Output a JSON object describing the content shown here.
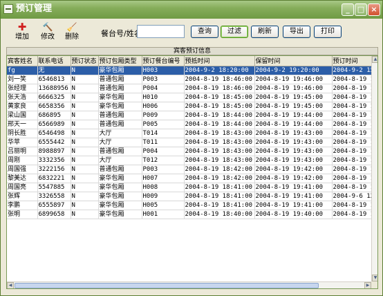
{
  "window": {
    "title": "预订管理"
  },
  "toolbar": {
    "tools": [
      {
        "label": "增加",
        "icon": "add-icon"
      },
      {
        "label": "修改",
        "icon": "hammer-icon"
      },
      {
        "label": "删除",
        "icon": "broom-icon"
      }
    ],
    "search_label": "餐台号/姓名：",
    "search_value": "",
    "buttons": [
      "查询",
      "过滤",
      "刷新",
      "导出",
      "打印"
    ],
    "active_button": "过滤"
  },
  "grid": {
    "section_title": "宾客预订信息",
    "columns": [
      "宾客姓名",
      "联系电话",
      "预订状态",
      "预订包厢类型",
      "预订餐台编号",
      "预抵时间",
      "保留时间",
      "预订时间"
    ],
    "rows": [
      [
        "fg",
        "无",
        "N",
        "豪华包厢",
        "H003",
        "2004-9-2 18:20:00",
        "2004-9-2 19:20:00",
        "2004-9-2 15"
      ],
      [
        "刘一笑",
        "6546813",
        "N",
        "普通包厢",
        "P003",
        "2004-8-19 18:46:00",
        "2004-8-19 19:46:00",
        "2004-8-19 1"
      ],
      [
        "张经理",
        "13688956",
        "N",
        "普通包厢",
        "P004",
        "2004-8-19 18:46:00",
        "2004-8-19 19:46:00",
        "2004-8-19 1"
      ],
      [
        "张天浩",
        "6666325",
        "N",
        "豪华包厢",
        "H010",
        "2004-8-19 18:45:00",
        "2004-8-19 19:45:00",
        "2004-8-19 1"
      ],
      [
        "黄家良",
        "6658356",
        "N",
        "豪华包厢",
        "H006",
        "2004-8-19 18:45:00",
        "2004-8-19 19:45:00",
        "2004-8-19 1"
      ],
      [
        "梁山国",
        "686895",
        "N",
        "普通包厢",
        "P009",
        "2004-8-19 18:44:00",
        "2004-8-19 19:44:00",
        "2004-8-19 1"
      ],
      [
        "邢天一",
        "6566989",
        "N",
        "普通包厢",
        "P005",
        "2004-8-19 18:44:00",
        "2004-8-19 19:44:00",
        "2004-8-19 1"
      ],
      [
        "阴长胜",
        "6546498",
        "N",
        "大厅",
        "T014",
        "2004-8-19 18:43:00",
        "2004-8-19 19:43:00",
        "2004-8-19 1"
      ],
      [
        "华苹",
        "6555442",
        "N",
        "大厅",
        "T011",
        "2004-8-19 18:43:00",
        "2004-8-19 19:43:00",
        "2004-8-19 1"
      ],
      [
        "吕丽明",
        "8988897",
        "N",
        "普通包厢",
        "P004",
        "2004-8-19 18:43:00",
        "2004-8-19 19:43:00",
        "2004-8-19 1"
      ],
      [
        "周刚",
        "3332356",
        "N",
        "大厅",
        "T012",
        "2004-8-19 18:43:00",
        "2004-8-19 19:43:00",
        "2004-8-19 1"
      ],
      [
        "周国强",
        "3222156",
        "N",
        "普通包厢",
        "P003",
        "2004-8-19 18:42:00",
        "2004-8-19 19:42:00",
        "2004-8-19 1"
      ],
      [
        "黎美达",
        "6832221",
        "N",
        "豪华包厢",
        "H007",
        "2004-8-19 18:42:00",
        "2004-8-19 19:42:00",
        "2004-8-19 1"
      ],
      [
        "周国亮",
        "5547885",
        "N",
        "豪华包厢",
        "H008",
        "2004-8-19 18:41:00",
        "2004-8-19 19:41:00",
        "2004-8-19 1"
      ],
      [
        "张辉",
        "3326558",
        "N",
        "豪华包厢",
        "H009",
        "2004-8-19 18:41:00",
        "2004-8-19 19:41:00",
        "2004-9-6 12"
      ],
      [
        "李鹏",
        "6555897",
        "N",
        "豪华包厢",
        "H005",
        "2004-8-19 18:41:00",
        "2004-8-19 19:41:00",
        "2004-8-19 1"
      ],
      [
        "张明",
        "6899658",
        "N",
        "豪华包厢",
        "H001",
        "2004-8-19 18:40:00",
        "2004-8-19 19:40:00",
        "2004-8-19 1"
      ]
    ],
    "selected_row": 0
  },
  "colors": {
    "title_bar": "#86ad5b",
    "selection": "#2c5ea8",
    "window_bg": "#ece9d8"
  }
}
